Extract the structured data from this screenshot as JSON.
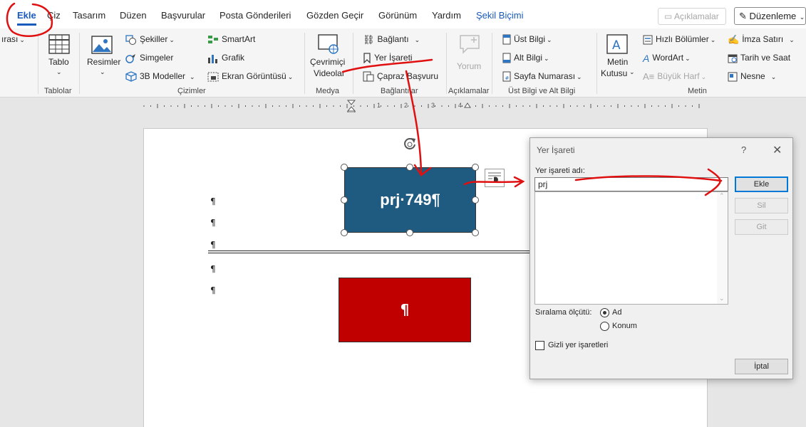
{
  "tabs": [
    {
      "label": "Ekle",
      "active": true
    },
    {
      "label": "Çiz"
    },
    {
      "label": "Tasarım"
    },
    {
      "label": "Düzen"
    },
    {
      "label": "Başvurular"
    },
    {
      "label": "Posta Gönderileri"
    },
    {
      "label": "Gözden Geçir"
    },
    {
      "label": "Görünüm"
    },
    {
      "label": "Yardım"
    },
    {
      "label": "Şekil Biçimi",
      "contextual": true
    }
  ],
  "topright": {
    "comments": "Açıklamalar",
    "editing": "Düzenleme"
  },
  "ribbon": {
    "pages_cut": "ırası",
    "table": "Tablo",
    "pictures": "Resimler",
    "shapes": "Şekiller",
    "icons": "Simgeler",
    "models3d": "3B Modeller",
    "smartart": "SmartArt",
    "chart": "Grafik",
    "screenshot": "Ekran Görüntüsü",
    "online_video_line1": "Çevrimiçi",
    "online_video_line2": "Videolar",
    "link": "Bağlantı",
    "bookmark": "Yer İşareti",
    "crossref": "Çapraz Başvuru",
    "comment": "Yorum",
    "header": "Üst Bilgi",
    "footer": "Alt Bilgi",
    "page_number": "Sayfa Numarası",
    "textbox_line1": "Metin",
    "textbox_line2": "Kutusu",
    "quickparts": "Hızlı Bölümler",
    "wordart": "WordArt",
    "dropcap": "Büyük Harf",
    "signature": "İmza Satırı",
    "datetime": "Tarih ve Saat",
    "object": "Nesne",
    "groups": {
      "tables": "Tablolar",
      "illustrations": "Çizimler",
      "media": "Medya",
      "links": "Bağlantılar",
      "comments": "Açıklamalar",
      "headerfooter": "Üst Bilgi ve Alt Bilgi",
      "text": "Metin"
    }
  },
  "ruler": {
    "numbers": [
      "1",
      "2",
      "3",
      "4"
    ]
  },
  "document": {
    "blue_shape_text": "prj·749¶",
    "red_shape_text": "¶",
    "pilcrow": "¶"
  },
  "dialog": {
    "title": "Yer İşareti",
    "help": "?",
    "close": "✕",
    "name_label": "Yer işareti adı:",
    "name_value": "prj",
    "buttons": {
      "add": "Ekle",
      "delete": "Sil",
      "goto": "Git",
      "cancel": "İptal"
    },
    "sort_label": "Sıralama ölçütü:",
    "sort_options": [
      {
        "label": "Ad",
        "selected": true
      },
      {
        "label": "Konum",
        "selected": false
      }
    ],
    "hidden_label": "Gizli yer işaretleri",
    "hidden_checked": false
  },
  "colors": {
    "accent": "#185abd",
    "blue_shape": "#1f5b80",
    "red_shape": "#c00000",
    "annotation": "#e01010"
  }
}
